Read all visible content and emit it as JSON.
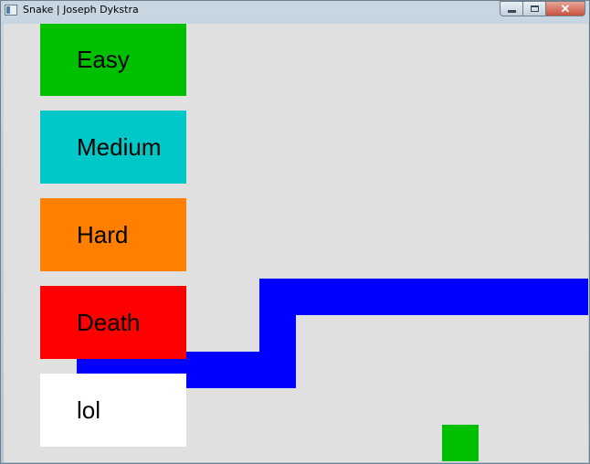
{
  "window": {
    "title": "Snake | Joseph Dykstra"
  },
  "colors": {
    "window_background": "#e0e0e0",
    "snake": "#0000ff",
    "food": "#00c000",
    "easy": "#00c000",
    "medium": "#00c8c8",
    "hard": "#ff8000",
    "death": "#ff0000",
    "lol": "#ffffff"
  },
  "menu": {
    "buttons": [
      {
        "id": "easy",
        "label": "Easy"
      },
      {
        "id": "medium",
        "label": "Medium"
      },
      {
        "id": "hard",
        "label": "Hard"
      },
      {
        "id": "death",
        "label": "Death"
      },
      {
        "id": "lol",
        "label": "lol"
      }
    ]
  },
  "game": {
    "grid_columns": 16,
    "grid_rows": 12,
    "snake": [
      [
        2,
        9
      ],
      [
        3,
        9
      ],
      [
        4,
        9
      ],
      [
        5,
        9
      ],
      [
        6,
        9
      ],
      [
        7,
        9
      ],
      [
        7,
        8
      ],
      [
        7,
        7
      ],
      [
        8,
        7
      ],
      [
        9,
        7
      ],
      [
        10,
        7
      ],
      [
        11,
        7
      ],
      [
        12,
        7
      ],
      [
        13,
        7
      ],
      [
        14,
        7
      ],
      [
        15,
        7
      ],
      [
        16,
        7
      ]
    ],
    "food": [
      12,
      11
    ]
  }
}
